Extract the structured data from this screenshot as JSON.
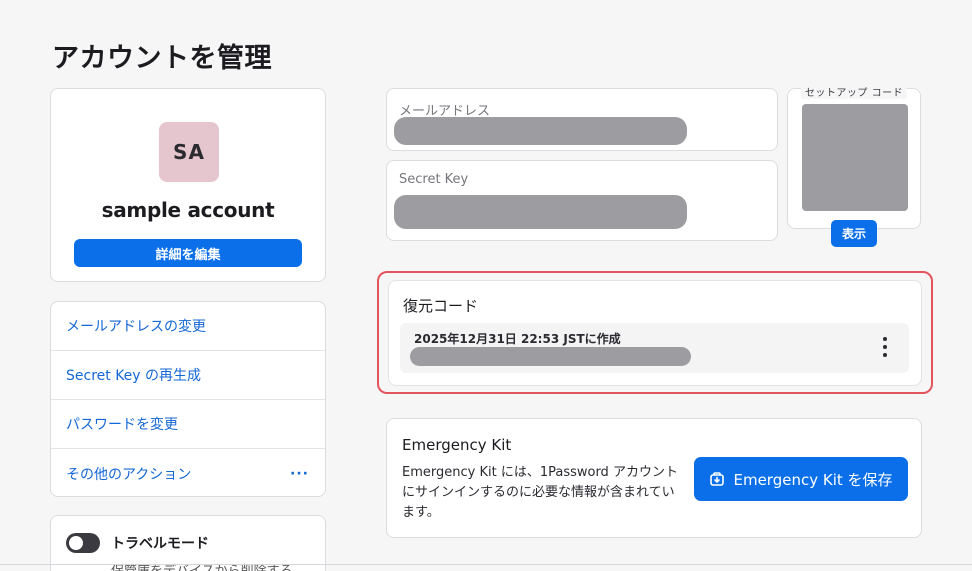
{
  "page_title": "アカウントを管理",
  "profile": {
    "avatar_initials": "SA",
    "avatar_color": "#e6c6ce",
    "name": "sample account",
    "edit_label": "詳細を編集"
  },
  "actions": {
    "items": [
      {
        "label": "メールアドレスの変更"
      },
      {
        "label": "Secret Key の再生成"
      },
      {
        "label": "パスワードを変更"
      },
      {
        "label": "その他のアクション",
        "more": "···"
      }
    ]
  },
  "travel": {
    "title": "トラベルモード",
    "description": "保管庫をデバイスから削除する"
  },
  "fields": {
    "email_label": "メールアドレス",
    "secret_key_label": "Secret Key"
  },
  "setup_code": {
    "label": "セットアップ コード",
    "show_label": "表示"
  },
  "recovery": {
    "title": "復元コード",
    "created": "2025年12月31日 22:53 JSTに作成"
  },
  "emergency_kit": {
    "title": "Emergency Kit",
    "description": "Emergency Kit には、1Password アカウントにサインインするのに必要な情報が含まれています。",
    "save_label": "Emergency Kit を保存"
  },
  "colors": {
    "accent": "#0a6fe8",
    "highlight": "#e2555d",
    "redacted": "#9d9da1"
  }
}
